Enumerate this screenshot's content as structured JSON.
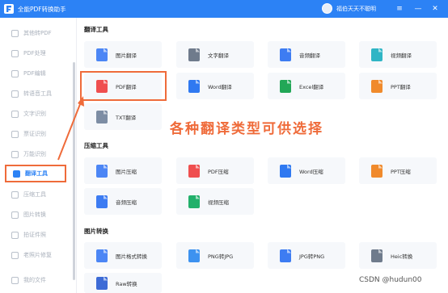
{
  "window": {
    "title": "全能PDF转换助手",
    "user": "福伯天天不聪明"
  },
  "winctl": {
    "menu": "≡",
    "minimize": "—",
    "close": "✕"
  },
  "sidebar": {
    "items": [
      {
        "label": "其他转PDF"
      },
      {
        "label": "PDF处理"
      },
      {
        "label": "PDF编辑"
      },
      {
        "label": "转语音工具"
      },
      {
        "label": "文字识别"
      },
      {
        "label": "票证识别"
      },
      {
        "label": "万能识别"
      },
      {
        "label": "翻译工具"
      },
      {
        "label": "压缩工具"
      },
      {
        "label": "图片转换"
      },
      {
        "label": "拍证件照"
      },
      {
        "label": "老照片修复"
      },
      {
        "label": "我的文件"
      }
    ],
    "active": "翻译工具"
  },
  "sections": {
    "translate": {
      "title": "翻译工具",
      "tools": [
        {
          "label": "图片翻译",
          "color": "#4c86f5"
        },
        {
          "label": "文字翻译",
          "color": "#6f7b8c"
        },
        {
          "label": "音频翻译",
          "color": "#3d7cf2"
        },
        {
          "label": "视频翻译",
          "color": "#2fb5c5"
        },
        {
          "label": "PDF翻译",
          "color": "#ef4f4f"
        },
        {
          "label": "Word翻译",
          "color": "#2f79f1"
        },
        {
          "label": "Excel翻译",
          "color": "#22a757"
        },
        {
          "label": "PPT翻译",
          "color": "#f08a2c"
        },
        {
          "label": "TXT翻译",
          "color": "#7d8da4"
        }
      ]
    },
    "compress": {
      "title": "压缩工具",
      "tools": [
        {
          "label": "图片压缩",
          "color": "#4c86f5"
        },
        {
          "label": "PDF压缩",
          "color": "#ef4f4f"
        },
        {
          "label": "Word压缩",
          "color": "#2f79f1"
        },
        {
          "label": "PPT压缩",
          "color": "#f08a2c"
        },
        {
          "label": "音频压缩",
          "color": "#3d7cf2"
        },
        {
          "label": "视频压缩",
          "color": "#22b06b"
        }
      ]
    },
    "image": {
      "title": "图片转换",
      "tools": [
        {
          "label": "图片格式转换",
          "color": "#4c86f5"
        },
        {
          "label": "PNG转JPG",
          "color": "#3d92f0"
        },
        {
          "label": "JPG转PNG",
          "color": "#3d7cf2"
        },
        {
          "label": "Heic转换",
          "color": "#6f7b8c"
        },
        {
          "label": "Raw转换",
          "color": "#3d6bd6"
        }
      ]
    }
  },
  "annotation": {
    "banner": "各种翻译类型可供选择"
  },
  "watermark": "CSDN @hudun00",
  "colors": {
    "accent": "#2c82f5",
    "highlight": "#ef6b3a"
  }
}
